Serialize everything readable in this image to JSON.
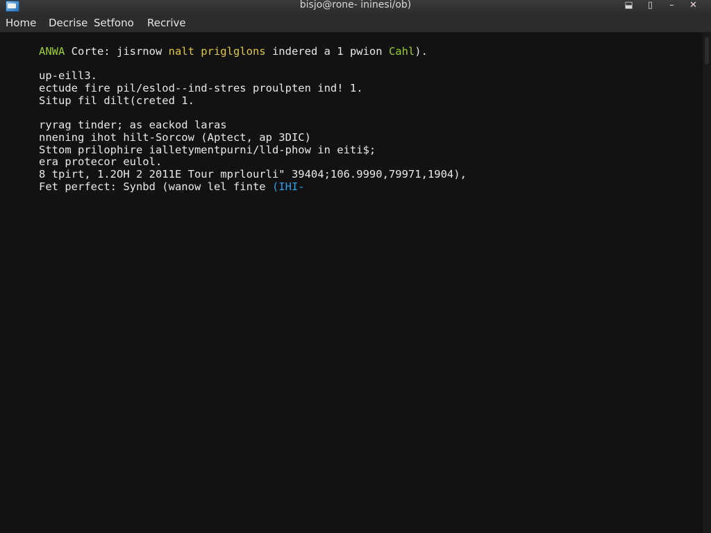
{
  "window": {
    "title": "bisjo@rone- ininesi/ob)",
    "controls": {
      "pin": "⬓",
      "restore": "▯",
      "minimize": "–",
      "close": "✕"
    }
  },
  "menu": {
    "items": [
      {
        "label": "Home"
      },
      {
        "label": "Decrise"
      },
      {
        "label": "Setfono"
      },
      {
        "label": "Recrive"
      }
    ]
  },
  "terminal": {
    "lines": [
      {
        "segments": [
          {
            "text": "ANWA",
            "color": "green"
          },
          {
            "text": " Corte: jisrnow ",
            "color": "default"
          },
          {
            "text": "nalt priglglons",
            "color": "yellow"
          },
          {
            "text": " indered a 1 pwion ",
            "color": "default"
          },
          {
            "text": "Cahl",
            "color": "green"
          },
          {
            "text": ").",
            "color": "default"
          }
        ]
      },
      {
        "segments": [
          {
            "text": "up-eill3.",
            "color": "default"
          }
        ]
      },
      {
        "segments": [
          {
            "text": "ectude fire pil/eslod--ind-stres proulpten ind! 1.",
            "color": "default"
          }
        ]
      },
      {
        "segments": [
          {
            "text": "Situp fil dilt(creted 1.",
            "color": "default"
          }
        ]
      },
      {
        "segments": [
          {
            "text": "ryrag tinder; as eackod laras",
            "color": "default"
          }
        ]
      },
      {
        "segments": [
          {
            "text": "nnening ihot hilt-Sorcow (Aptect, ap 3DIC)",
            "color": "default"
          }
        ]
      },
      {
        "segments": [
          {
            "text": "Sttom prilophire ialletymentpurni/lld-phow in eiti$;",
            "color": "default"
          }
        ]
      },
      {
        "segments": [
          {
            "text": "era protecor eulol.",
            "color": "default"
          }
        ]
      },
      {
        "segments": [
          {
            "text": "8 tpirt, 1.2OH 2 2011E Tour mprlourli\" 39404;106.9990,79971,1904),",
            "color": "default"
          }
        ]
      },
      {
        "segments": [
          {
            "text": "Fet perfect: Synbd (wanow lel finte ",
            "color": "default"
          },
          {
            "text": "(IHI-",
            "color": "blue"
          }
        ]
      }
    ]
  }
}
